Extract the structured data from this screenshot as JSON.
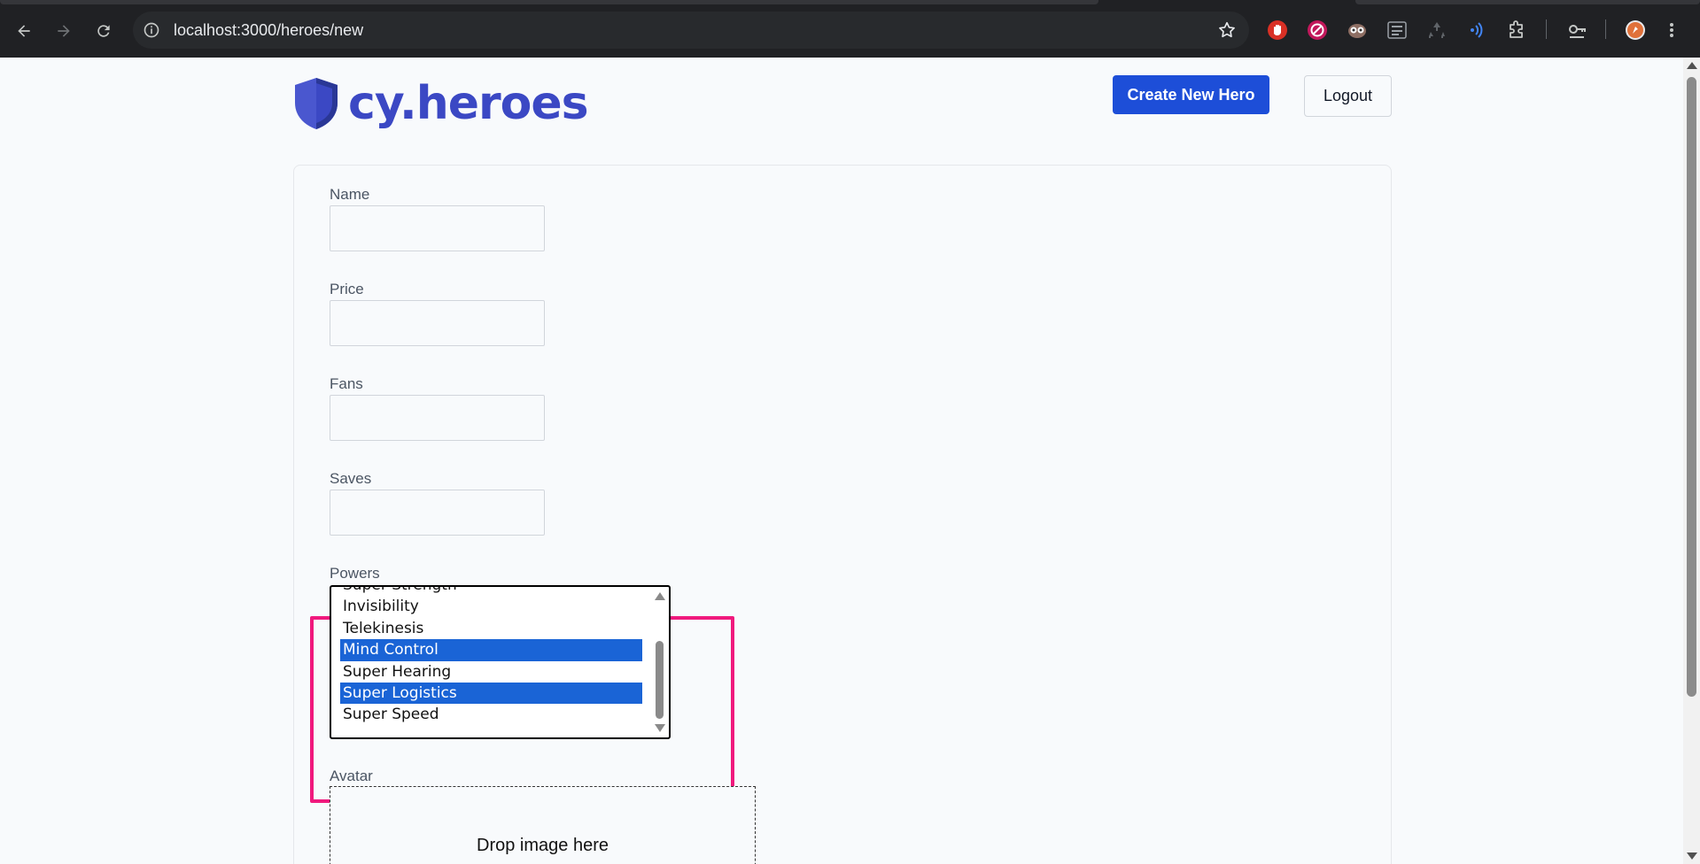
{
  "browser": {
    "url": "localhost:3000/heroes/new"
  },
  "header": {
    "logo_text": "cy.heroes",
    "create_button": "Create New Hero",
    "logout_button": "Logout"
  },
  "form": {
    "name_label": "Name",
    "price_label": "Price",
    "fans_label": "Fans",
    "saves_label": "Saves",
    "powers_label": "Powers",
    "powers_options": [
      {
        "label": "Super Strength",
        "selected": false
      },
      {
        "label": "Invisibility",
        "selected": false
      },
      {
        "label": "Telekinesis",
        "selected": false
      },
      {
        "label": "Mind Control",
        "selected": true
      },
      {
        "label": "Super Hearing",
        "selected": false
      },
      {
        "label": "Super Logistics",
        "selected": true
      },
      {
        "label": "Super Speed",
        "selected": false
      }
    ],
    "avatar_label": "Avatar",
    "dropzone_text": "Drop image here"
  },
  "colors": {
    "brand": "#3b48c4",
    "primary_button": "#1d4ed8",
    "selection": "#1a64d6",
    "highlight_border": "#f0197d"
  }
}
